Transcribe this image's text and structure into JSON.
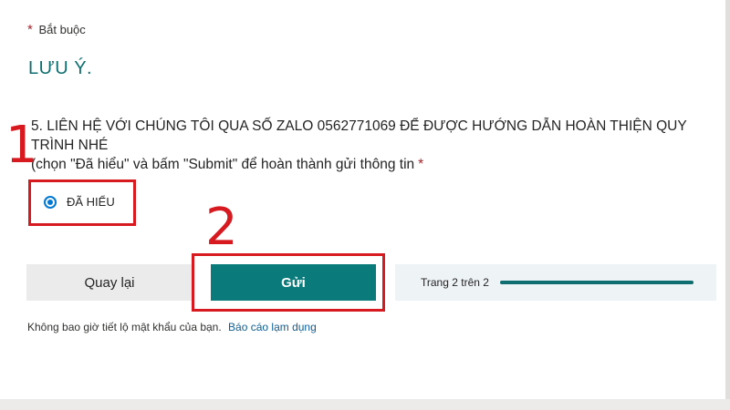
{
  "form": {
    "required_star": "*",
    "required_text": "Bắt buộc",
    "section_title": "LƯU Ý.",
    "question": {
      "text": "5. LIÊN HỆ VỚI CHÚNG TÔI QUA SỐ ZALO 0562771069 ĐỂ ĐƯỢC HƯỚNG DẪN HOÀN THIỆN QUY TRÌNH NHÉ",
      "note": "(chọn \"Đã hiểu\" và bấm \"Submit\" để hoàn thành gửi thông tin",
      "required_star": "*"
    },
    "option": {
      "label": "ĐÃ HIỂU",
      "selected": true
    }
  },
  "annotations": {
    "step1": "1",
    "step2": "2",
    "color": "#d71920"
  },
  "nav": {
    "back_label": "Quay lại",
    "submit_label": "Gửi",
    "progress_text": "Trang 2 trên 2",
    "progress_fraction": 1.0
  },
  "footer": {
    "text": "Không bao giờ tiết lộ mật khẩu của bạn.",
    "link": "Báo cáo lạm dụng"
  },
  "colors": {
    "accent": "#0b7a7a",
    "radio": "#0078d4",
    "required": "#a4262c"
  }
}
